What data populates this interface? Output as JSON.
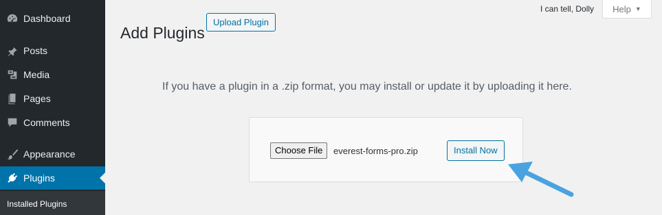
{
  "sidebar": {
    "items": [
      {
        "label": "Dashboard",
        "icon": "dashboard-icon"
      },
      {
        "label": "Posts",
        "icon": "pin-icon"
      },
      {
        "label": "Media",
        "icon": "media-icon"
      },
      {
        "label": "Pages",
        "icon": "pages-icon"
      },
      {
        "label": "Comments",
        "icon": "comment-icon"
      },
      {
        "label": "Appearance",
        "icon": "brush-icon"
      },
      {
        "label": "Plugins",
        "icon": "plugin-icon",
        "active": true
      }
    ],
    "submenu": [
      "Installed Plugins"
    ]
  },
  "header": {
    "title": "Add Plugins",
    "upload_button": "Upload Plugin",
    "howdy": "I can tell, Dolly",
    "help_tab": "Help"
  },
  "main": {
    "help_text": "If you have a plugin in a .zip format, you may install or update it by uploading it here.",
    "choose_file_label": "Choose File",
    "file_name": "everest-forms-pro.zip",
    "install_button": "Install Now"
  },
  "colors": {
    "sidebar_bg": "#23282d",
    "active_menu": "#0073aa",
    "accent": "#0071a1",
    "arrow": "#4aa3df"
  }
}
